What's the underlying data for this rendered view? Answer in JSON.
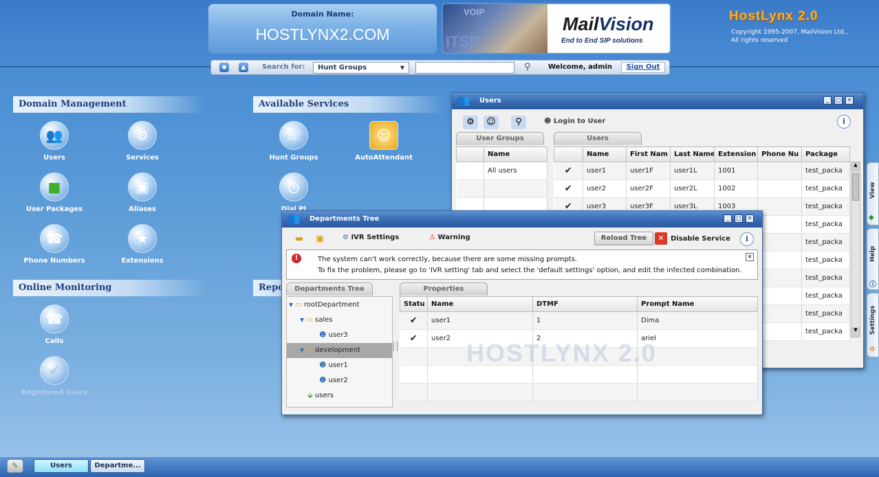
{
  "header": {
    "domain_label": "Domain Name:",
    "domain_value": "HOSTLYNX2.COM",
    "banner_voip": "VOIP",
    "banner_itsp": "ITSP",
    "banner_brand_a": "Mail",
    "banner_brand_b": "Vision",
    "banner_tagline": "End to End SIP solutions",
    "product": "HostLynx 2.0",
    "copyright_1": "Copyright 1995-2007, MailVision Ltd.,",
    "copyright_2": "All rights reserved"
  },
  "search": {
    "label": "Search for:",
    "selected": "Hunt Groups",
    "input_value": "",
    "welcome": "Welcome, admin",
    "signout": "Sign Out"
  },
  "sections": {
    "domain_management": "Domain Management",
    "available_services": "Available Services",
    "online_monitoring": "Online Monitoring",
    "reports": "Repo"
  },
  "tiles": {
    "users": "Users",
    "services": "Services",
    "user_packages": "User Packages",
    "aliases": "Aliases",
    "phone_numbers": "Phone Numbers",
    "extensions": "Extensions",
    "hunt_groups": "Hunt Groups",
    "auto_attendant": "AutoAttendant",
    "dial_plan": "Dial Pl",
    "calls": "Calls",
    "registered_users": "Registered Users"
  },
  "users_window": {
    "title": "Users",
    "login_to_user": "Login to User",
    "tab_groups": "User Groups",
    "tab_users": "Users",
    "groups_header": "Name",
    "groups": [
      "All users"
    ],
    "columns": [
      "Name",
      "First Nam",
      "Last Name",
      "Extension",
      "Phone Nu",
      "Package"
    ],
    "rows": [
      {
        "status": "✔",
        "name": "user1",
        "first": "user1F",
        "last": "user1L",
        "ext": "1001",
        "phone": "",
        "package": "test_packa"
      },
      {
        "status": "✔",
        "name": "user2",
        "first": "user2F",
        "last": "user2L",
        "ext": "1002",
        "phone": "",
        "package": "test_packa"
      },
      {
        "status": "✔",
        "name": "user3",
        "first": "user3F",
        "last": "user3L",
        "ext": "1003",
        "phone": "",
        "package": "test_packa"
      },
      {
        "status": "",
        "name": "",
        "first": "",
        "last": "",
        "ext": "",
        "phone": "",
        "package": "test_packa"
      },
      {
        "status": "",
        "name": "",
        "first": "",
        "last": "",
        "ext": "",
        "phone": "",
        "package": "test_packa"
      },
      {
        "status": "",
        "name": "",
        "first": "",
        "last": "",
        "ext": "",
        "phone": "",
        "package": "test_packa"
      },
      {
        "status": "",
        "name": "",
        "first": "",
        "last": "",
        "ext": "",
        "phone": "",
        "package": "test_packa"
      },
      {
        "status": "",
        "name": "",
        "first": "",
        "last": "",
        "ext": "",
        "phone": "",
        "package": "test_packa"
      },
      {
        "status": "",
        "name": "",
        "first": "",
        "last": "",
        "ext": "",
        "phone": "",
        "package": "test_packa"
      },
      {
        "status": "",
        "name": "",
        "first": "",
        "last": "",
        "ext": "",
        "phone": "",
        "package": "test_packa"
      }
    ]
  },
  "dept_window": {
    "title": "Departments Tree",
    "ivr_settings": "IVR Settings",
    "warning": "Warning",
    "reload_tree": "Reload Tree",
    "disable_service": "Disable Service",
    "message_1": "The system can't work correctly, because there are some missing prompts.",
    "message_2": "To fix the problem, please go to 'IVR setting' tab and select the 'default settings' option, and edit the infected combination.",
    "tab_tree": "Departments Tree",
    "tab_properties": "Properties",
    "tree": {
      "root": "rootDepartment",
      "sales": "sales",
      "sales_user3": "user3",
      "development": "development",
      "dev_user1": "user1",
      "dev_user2": "user2",
      "users": "users"
    },
    "columns": [
      "Statu",
      "Name",
      "DTMF",
      "Prompt Name"
    ],
    "rows": [
      {
        "status": "✔",
        "name": "user1",
        "dtmf": "1",
        "prompt": "Dima"
      },
      {
        "status": "✔",
        "name": "user2",
        "dtmf": "2",
        "prompt": "ariel"
      },
      {
        "status": "",
        "name": "",
        "dtmf": "",
        "prompt": ""
      },
      {
        "status": "",
        "name": "",
        "dtmf": "",
        "prompt": ""
      },
      {
        "status": "",
        "name": "",
        "dtmf": "",
        "prompt": ""
      }
    ],
    "watermark": "HOSTLYNX 2.0"
  },
  "side_tabs": {
    "view": "View",
    "help": "Help",
    "settings": "Settings"
  },
  "taskbar": {
    "task_users": "Users",
    "task_departments": "Departme..."
  }
}
